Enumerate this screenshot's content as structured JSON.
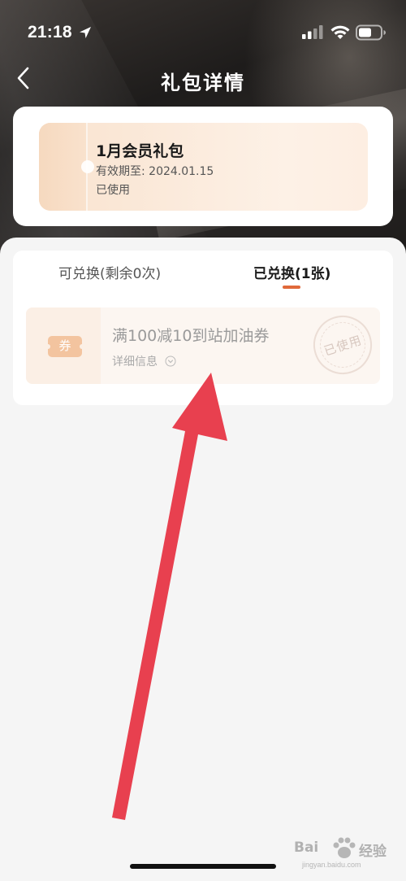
{
  "status_bar": {
    "time": "21:18"
  },
  "nav": {
    "title": "礼包详情"
  },
  "gift": {
    "name": "1月会员礼包",
    "validity": "有效期至: 2024.01.15",
    "status": "已使用"
  },
  "tabs": [
    {
      "label": "可兑换(剩余0次)",
      "active": false
    },
    {
      "label": "已兑换(1张)",
      "active": true
    }
  ],
  "coupon": {
    "badge": "券",
    "title": "满100减10到站加油券",
    "detail_label": "详细信息",
    "stamp": "已使用"
  },
  "watermark": {
    "brand": "Bai",
    "suffix": "经验",
    "url": "jingyan.baidu.com"
  },
  "colors": {
    "accent": "#e0693a",
    "arrow": "#e8404f",
    "ticket": "#f9e3cf"
  }
}
